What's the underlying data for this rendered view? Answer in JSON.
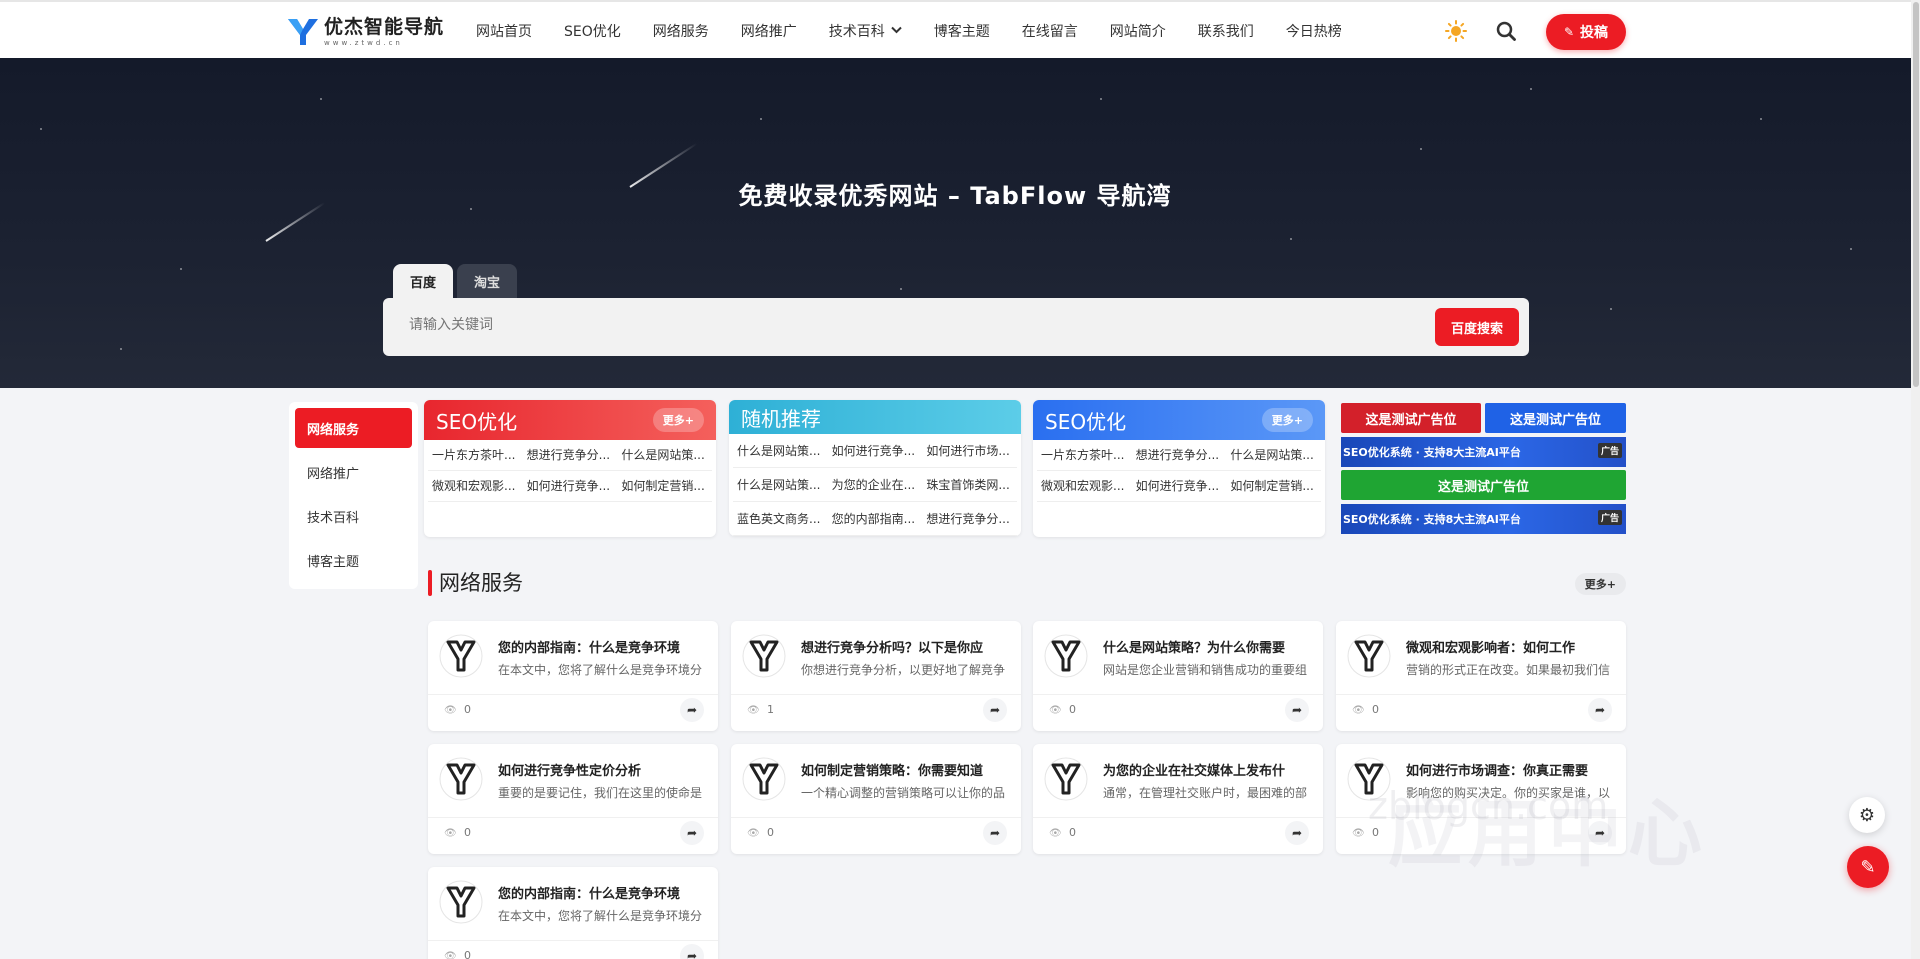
{
  "header": {
    "logo_title": "优杰智能导航",
    "logo_sub": "www.ztwd.cn",
    "nav": [
      "网站首页",
      "SEO优化",
      "网络服务",
      "网络推广",
      "技术百科",
      "博客主题",
      "在线留言",
      "网站简介",
      "联系我们",
      "今日热榜"
    ],
    "submit_label": "投稿"
  },
  "hero": {
    "title": "免费收录优秀网站 – TabFlow 导航湾",
    "tabs": [
      "百度",
      "淘宝"
    ],
    "search_placeholder": "请输入关键词",
    "search_button": "百度搜索"
  },
  "sidebar": {
    "items": [
      "网络服务",
      "网络推广",
      "技术百科",
      "博客主题"
    ]
  },
  "panels": [
    {
      "title": "SEO优化",
      "more": "更多+",
      "color": "#ec1c24",
      "items": [
        "一片东方茶叶...",
        "想进行竞争分...",
        "什么是网站策...",
        "微观和宏观影...",
        "如何进行竞争...",
        "如何制定营销..."
      ]
    },
    {
      "title": "随机推荐",
      "more": "",
      "color": "#3cb8d8",
      "items": [
        "什么是网站策...",
        "如何进行竞争...",
        "如何进行市场...",
        "什么是网站策...",
        "为您的企业在...",
        "珠宝首饰类网...",
        "蓝色英文商务...",
        "您的内部指南...",
        "想进行竞争分..."
      ]
    },
    {
      "title": "SEO优化",
      "more": "更多+",
      "color": "#2f7bf0",
      "items": [
        "一片东方茶叶...",
        "想进行竞争分...",
        "什么是网站策...",
        "微观和宏观影...",
        "如何进行竞争...",
        "如何制定营销..."
      ]
    }
  ],
  "ads": {
    "test_label": "这是测试广告位",
    "banner_text": "SEO优化系统 · 支持8大主流AI平台",
    "banner_tag": "广告",
    "colors": {
      "red": "#d3202a",
      "blue": "#1f62e6",
      "green": "#1fa533"
    }
  },
  "section": {
    "title": "网络服务",
    "more": "更多+",
    "cards": [
      {
        "title": "您的内部指南：什么是竞争环境",
        "desc": "在本文中，您将了解什么是竞争环境分",
        "views": "0"
      },
      {
        "title": "想进行竞争分析吗？以下是你应",
        "desc": "你想进行竞争分析，以更好地了解竞争",
        "views": "1"
      },
      {
        "title": "什么是网站策略？为什么你需要",
        "desc": "网站是您企业营销和销售成功的重要组",
        "views": "0"
      },
      {
        "title": "微观和宏观影响者：如何工作",
        "desc": "营销的形式正在改变。如果最初我们信",
        "views": "0"
      },
      {
        "title": "如何进行竞争性定价分析",
        "desc": "重要的是要记住，我们在这里的使命是",
        "views": "0"
      },
      {
        "title": "如何制定营销策略：你需要知道",
        "desc": "一个精心调整的营销策略可以让你的品",
        "views": "0"
      },
      {
        "title": "为您的企业在社交媒体上发布什",
        "desc": "通常，在管理社交账户时，最困难的部",
        "views": "0"
      },
      {
        "title": "如何进行市场调查：你真正需要",
        "desc": "影响您的购买决定。你的买家是谁，以",
        "views": "0"
      },
      {
        "title": "您的内部指南：什么是竞争环境",
        "desc": "在本文中，您将了解什么是竞争环境分",
        "views": "0"
      }
    ]
  },
  "watermark": {
    "text": "应用中心",
    "url": "zblogcn.com"
  },
  "colors": {
    "accent": "#ec1c24"
  }
}
